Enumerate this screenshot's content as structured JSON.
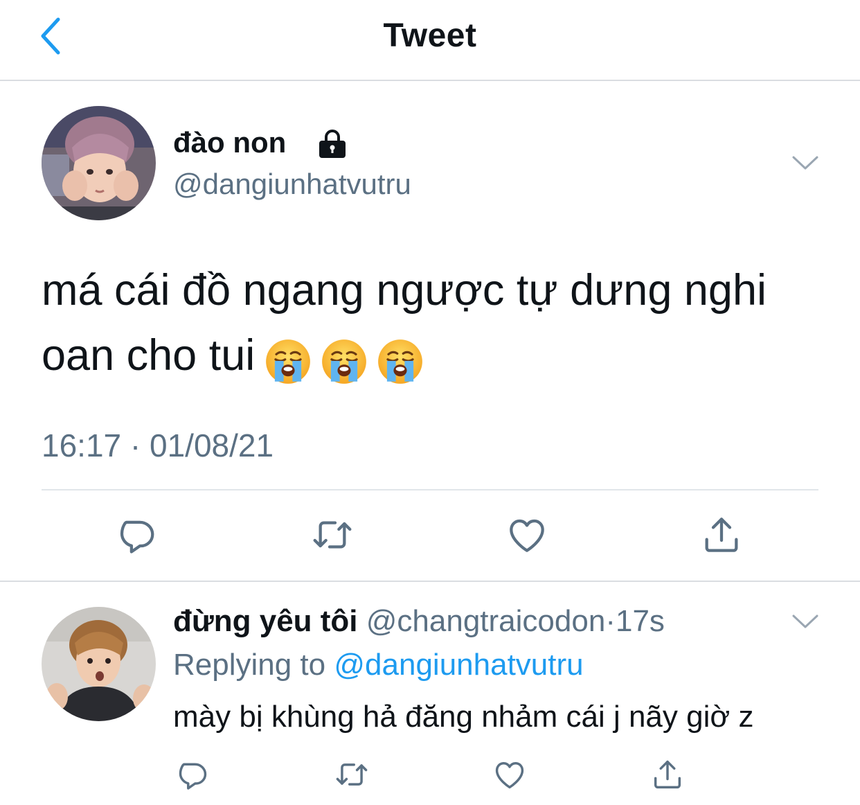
{
  "header": {
    "title": "Tweet",
    "back_icon": "chevron-left-icon"
  },
  "colors": {
    "accent": "#1d9bf0",
    "secondary_text": "#5b7083",
    "primary_text": "#0f1419",
    "divider": "#e1e6ea"
  },
  "main_tweet": {
    "display_name": "đào non",
    "protected_icon": "lock-icon",
    "handle": "@dangiunhatvutru",
    "text_line_1": "má cái đồ ngang ngược tự dưng nghi",
    "text_line_2": "oan cho tui",
    "emojis": [
      "loudly-crying-face",
      "loudly-crying-face",
      "loudly-crying-face"
    ],
    "timestamp": "16:17 · 01/08/21",
    "actions": [
      "reply-icon",
      "retweet-icon",
      "like-icon",
      "share-icon"
    ]
  },
  "reply_tweet": {
    "display_name": "đừng yêu tôi",
    "handle": "@changtraicodon",
    "time_sep": "·",
    "time_ago": "17s",
    "replying_prefix": "Replying to",
    "replying_to": "@dangiunhatvutru",
    "text": "mày bị khùng hả đăng nhảm cái j nãy giờ z",
    "actions": [
      "reply-icon",
      "retweet-icon",
      "like-icon",
      "share-icon"
    ]
  }
}
